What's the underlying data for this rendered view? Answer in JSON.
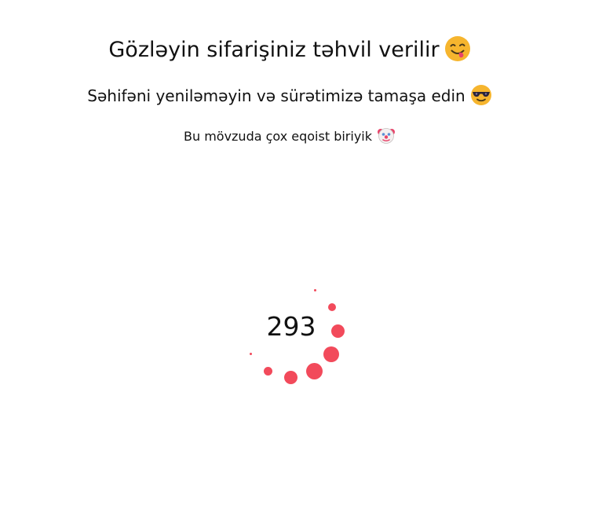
{
  "header": {
    "title": "Gözləyin sifarişiniz təhvil verilir",
    "title_icon": "face-savoring-food-icon",
    "subtitle": "Səhifəni yeniləməyin və sürətimizə tamaşa edin",
    "subtitle_icon": "smiling-face-with-sunglasses-icon",
    "note": "Bu mövzuda çox eqoist biriyik",
    "note_icon": "clown-face-icon"
  },
  "loader": {
    "counter": "293",
    "accent_color": "#f24a5b"
  }
}
